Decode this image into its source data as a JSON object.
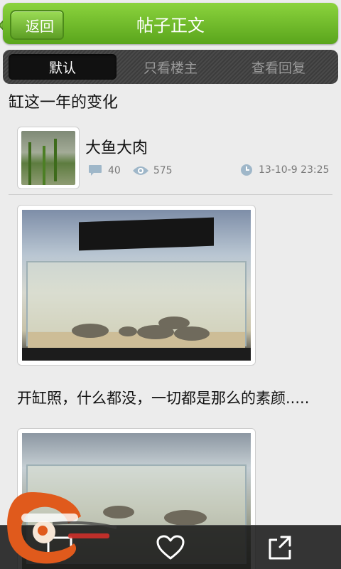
{
  "header": {
    "back_label": "返回",
    "title": "帖子正文"
  },
  "tabs": [
    {
      "label": "默认",
      "active": true
    },
    {
      "label": "只看楼主",
      "active": false
    },
    {
      "label": "查看回复",
      "active": false
    }
  ],
  "post": {
    "title": "缸这一年的变化",
    "author": "大鱼大肉",
    "comment_count": "40",
    "view_count": "575",
    "timestamp": "13-10-9 23:25",
    "caption": "开缸照，什么都没，一切都是那么的素颜....."
  },
  "bottom_bar": {
    "icons": [
      "reply-icon",
      "heart-icon",
      "share-icon"
    ]
  },
  "colors": {
    "header_green": "#6fbe2a",
    "tab_bar": "#424242",
    "meta_icon": "#9fb7c9"
  }
}
